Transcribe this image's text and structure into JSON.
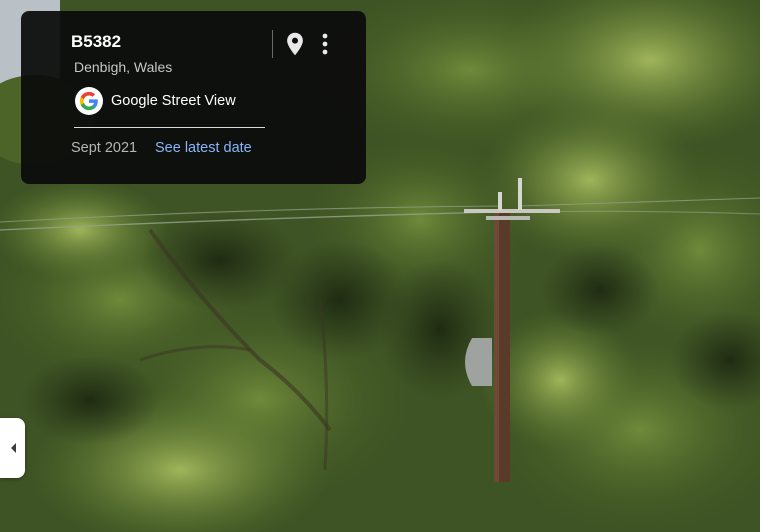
{
  "location": {
    "road": "B5382",
    "place": "Denbigh, Wales"
  },
  "provider": {
    "label": "Google Street View",
    "logo_icon": "google-g-icon"
  },
  "capture": {
    "date": "Sept 2021",
    "latest_link": "See latest date"
  },
  "actions": {
    "pin_icon": "location-pin-icon",
    "more_icon": "more-vert-icon"
  },
  "panel_toggle": {
    "icon": "chevron-left-icon"
  },
  "colors": {
    "card_bg": "#0c0c0c",
    "link": "#8ab4f8",
    "google_blue": "#4285F4",
    "google_red": "#EA4335",
    "google_yellow": "#FBBC05",
    "google_green": "#34A853"
  }
}
